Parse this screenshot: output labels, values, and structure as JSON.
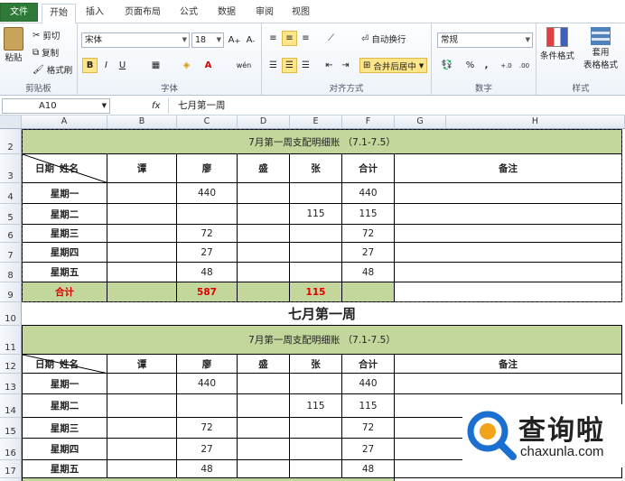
{
  "tabs": [
    "文件",
    "开始",
    "插入",
    "页面布局",
    "公式",
    "数据",
    "审阅",
    "视图"
  ],
  "ribbon": {
    "paste": "粘贴",
    "cut": "剪切",
    "copy": "复制",
    "format_painter": "格式刷",
    "font_name": "宋体",
    "font_size": "18",
    "bold": "B",
    "italic": "I",
    "underline": "U",
    "wen": "wén",
    "wrap_text": "自动换行",
    "merge_center": "合并后居中",
    "number_format": "常规",
    "percent": "%",
    "comma": ",",
    "inc_dec": "+.0 .00",
    "dec_dec": ".00 →.0",
    "cond_format": "条件格式",
    "table_format_1": "套用",
    "table_format_2": "表格格式",
    "groups": {
      "clipboard": "剪贴板",
      "font": "字体",
      "alignment": "对齐方式",
      "number": "数字",
      "styles": "样式"
    }
  },
  "formula_bar": {
    "name_box": "A10",
    "fx": "fx",
    "content": "七月第一周"
  },
  "columns": [
    "A",
    "B",
    "C",
    "D",
    "E",
    "F",
    "G",
    "H"
  ],
  "rows": [
    "2",
    "3",
    "4",
    "5",
    "6",
    "7",
    "8",
    "9",
    "10",
    "11",
    "12",
    "13",
    "14",
    "15",
    "16",
    "17"
  ],
  "table1": {
    "title": "7月第一周支配明细账 （7.1-7.5）",
    "header_date": "日期",
    "header_name": "姓名",
    "names": [
      "谭",
      "廖",
      "盛",
      "张"
    ],
    "total_label": "合计",
    "note_label": "备注",
    "days": [
      "星期一",
      "星期二",
      "星期三",
      "星期四",
      "星期五"
    ],
    "data": [
      [
        "",
        "440",
        "",
        "",
        "440"
      ],
      [
        "",
        "",
        "",
        "115",
        "115"
      ],
      [
        "",
        "72",
        "",
        "",
        "72"
      ],
      [
        "",
        "27",
        "",
        "",
        "27"
      ],
      [
        "",
        "48",
        "",
        "",
        "48"
      ]
    ],
    "sum_label": "合计",
    "sum_c": "587",
    "sum_e": "115"
  },
  "big_title": "七月第一周",
  "table2": {
    "title": "7月第一周支配明细账 （7.1-7.5）",
    "header_date": "日期",
    "header_name": "姓名",
    "names": [
      "谭",
      "廖",
      "盛",
      "张"
    ],
    "total_label": "合计",
    "note_label": "备注",
    "days": [
      "星期一",
      "星期二",
      "星期三",
      "星期四",
      "星期五"
    ],
    "data": [
      [
        "",
        "440",
        "",
        "",
        "440"
      ],
      [
        "",
        "",
        "",
        "115",
        "115"
      ],
      [
        "",
        "72",
        "",
        "",
        "72"
      ],
      [
        "",
        "27",
        "",
        "",
        "27"
      ],
      [
        "",
        "48",
        "",
        "",
        "48"
      ]
    ]
  },
  "watermark": {
    "cn": "查询啦",
    "url": "chaxunla.com",
    "color": "#1a6fd0"
  }
}
